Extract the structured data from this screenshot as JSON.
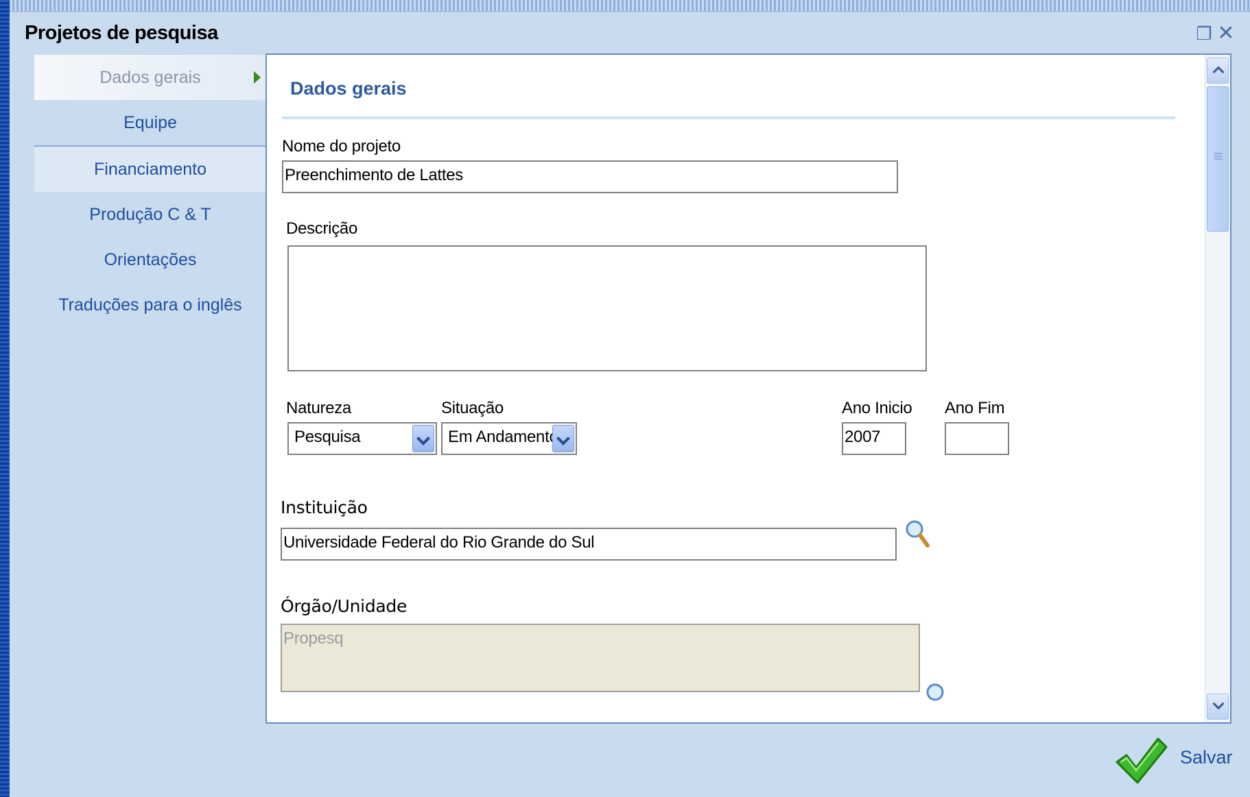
{
  "window": {
    "title": "Projetos de pesquisa",
    "restore_icon": "restore-icon",
    "close_icon": "close-icon"
  },
  "nav": {
    "items": [
      {
        "label": "Dados gerais"
      },
      {
        "label": "Equipe"
      },
      {
        "label": "Financiamento"
      },
      {
        "label": "Produção C & T"
      },
      {
        "label": "Orientações"
      },
      {
        "label": "Traduções para o inglês"
      }
    ]
  },
  "form": {
    "section_title": "Dados gerais",
    "nome_label": "Nome do projeto",
    "nome_value": "Preenchimento de Lattes",
    "descricao_label": "Descrição",
    "descricao_value": "",
    "natureza_label": "Natureza",
    "natureza_value": "Pesquisa",
    "situacao_label": "Situação",
    "situacao_value": "Em Andamento",
    "ano_inicio_label": "Ano Inicio",
    "ano_inicio_value": "2007",
    "ano_fim_label": "Ano Fim",
    "ano_fim_value": "",
    "instituicao_label": "Instituição",
    "instituicao_value": "Universidade Federal do Rio Grande do Sul",
    "orgao_label": "Órgão/Unidade",
    "orgao_value": "Propesq"
  },
  "footer": {
    "save_label": "Salvar"
  },
  "colors": {
    "accent": "#1d4fa0",
    "window_bg": "#c9dbee",
    "readonly_bg": "#ece8d8"
  }
}
